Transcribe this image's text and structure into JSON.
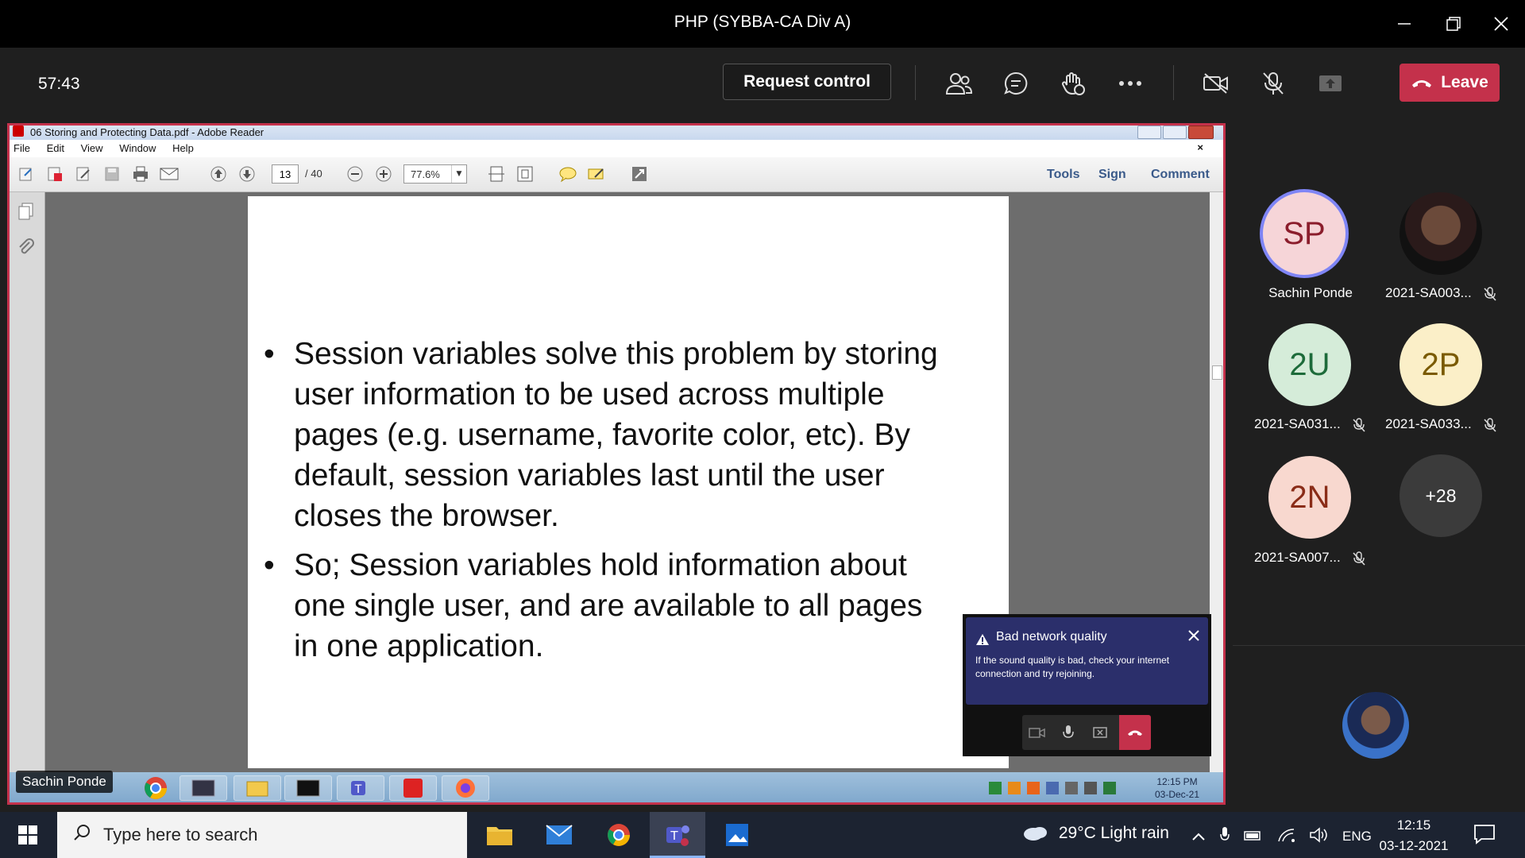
{
  "window": {
    "title": "PHP (SYBBA-CA Div A)"
  },
  "meeting": {
    "timer": "57:43",
    "request_control_label": "Request control",
    "leave_label": "Leave",
    "accent_leave": "#c4314b"
  },
  "adobe": {
    "title": "06 Storing and Protecting Data.pdf - Adobe Reader",
    "menu": [
      "File",
      "Edit",
      "View",
      "Window",
      "Help"
    ],
    "page_current": "13",
    "page_total": "/ 40",
    "zoom": "77.6%",
    "right_tools": [
      "Tools",
      "Sign",
      "Comment"
    ],
    "bullets": [
      [
        "Session variables solve this problem by storing",
        "user information to be used across multiple",
        "pages (e.g. username, favorite color, etc). By",
        "default, session variables last until the user",
        "closes the browser."
      ],
      [
        "So; Session variables hold information about",
        "one single user, and are available to all pages",
        "in one application."
      ]
    ],
    "remote_clock_time": "12:15 PM",
    "remote_clock_date": "03-Dec-21"
  },
  "presenter_name": "Sachin Ponde",
  "participants": [
    {
      "initials": "SP",
      "name": "Sachin Ponde",
      "muted": false,
      "bg": "#f6d5d8",
      "fg": "#8b1d2c"
    },
    {
      "initials": "",
      "name": "2021-SA003...",
      "muted": true,
      "bg": "#3a2020",
      "fg": "#fff"
    },
    {
      "initials": "2U",
      "name": "2021-SA031...",
      "muted": true,
      "bg": "#d5ecd9",
      "fg": "#1d6b3a"
    },
    {
      "initials": "2P",
      "name": "2021-SA033...",
      "muted": true,
      "bg": "#fbefc8",
      "fg": "#7a5a00"
    },
    {
      "initials": "2N",
      "name": "2021-SA007...",
      "muted": true,
      "bg": "#f8d8cf",
      "fg": "#8a2c18"
    },
    {
      "initials": "+28",
      "name": "",
      "muted": false,
      "bg": "#3b3b3b",
      "fg": "#fff"
    }
  ],
  "toast": {
    "title": "Bad network quality",
    "body": "If the sound quality is bad, check your internet connection and try rejoining."
  },
  "taskbar": {
    "search_placeholder": "Type here to search",
    "weather": "29°C  Light rain",
    "lang": "ENG",
    "time": "12:15",
    "date": "03-12-2021"
  }
}
